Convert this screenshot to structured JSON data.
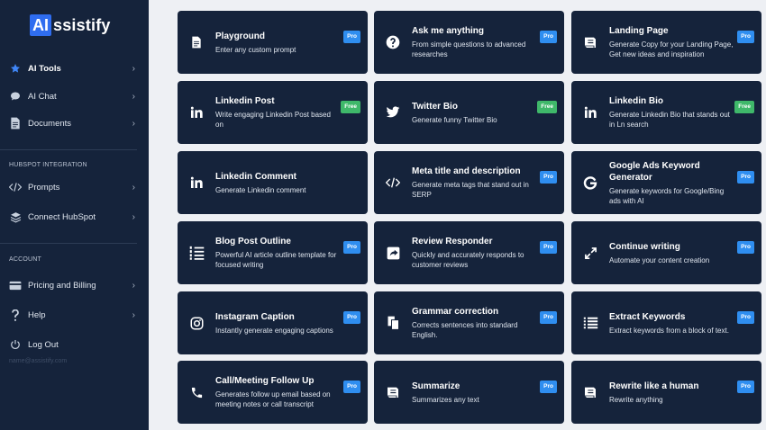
{
  "brand": {
    "box": "AI",
    "rest": "ssistify"
  },
  "sidebar": {
    "main": [
      {
        "label": "AI Tools",
        "icon": "star-icon",
        "active": true
      },
      {
        "label": "AI Chat",
        "icon": "chat-bubble-icon"
      },
      {
        "label": "Documents",
        "icon": "document-icon"
      }
    ],
    "hubspot_title": "HUBSPOT INTEGRATION",
    "hubspot": [
      {
        "label": "Prompts",
        "icon": "code-icon"
      },
      {
        "label": "Connect HubSpot",
        "icon": "layers-icon"
      }
    ],
    "account_title": "ACCOUNT",
    "account": [
      {
        "label": "Pricing and Billing",
        "icon": "credit-card-icon"
      },
      {
        "label": "Help",
        "icon": "question-icon"
      },
      {
        "label": "Log Out",
        "icon": "power-icon"
      }
    ],
    "email": "name@assistify.com"
  },
  "badges": {
    "pro": "Pro",
    "free": "Free"
  },
  "colors": {
    "sidebar_bg": "#15233b",
    "card_bg": "#15233b",
    "accent": "#2f6df0",
    "pro": "#2f8ef0",
    "free": "#3fb86a",
    "page_bg": "#eef0f4"
  },
  "tools": [
    {
      "title": "Playground",
      "desc": "Enter any custom prompt",
      "badge": "pro",
      "icon": "document-icon"
    },
    {
      "title": "Ask me anything",
      "desc": "From simple questions to advanced researches",
      "badge": "pro",
      "icon": "question-circle-icon"
    },
    {
      "title": "Landing Page",
      "desc": "Generate Copy for your Landing Page, Get new ideas and inspiration",
      "badge": "pro",
      "icon": "book-icon"
    },
    {
      "title": "Linkedin Post",
      "desc": "Write engaging Linkedin Post based on",
      "badge": "free",
      "icon": "linkedin-icon"
    },
    {
      "title": "Twitter Bio",
      "desc": "Generate funny Twitter Bio",
      "badge": "free",
      "icon": "twitter-icon"
    },
    {
      "title": "Linkedin Bio",
      "desc": "Generate Linkedin Bio that stands out in Ln search",
      "badge": "free",
      "icon": "linkedin-icon"
    },
    {
      "title": "Linkedin Comment",
      "desc": "Generate Linkedin comment",
      "badge": "",
      "icon": "linkedin-icon"
    },
    {
      "title": "Meta title and description",
      "desc": "Generate meta tags that stand out in SERP",
      "badge": "pro",
      "icon": "code-icon"
    },
    {
      "title": "Google Ads Keyword Generator",
      "desc": "Generate keywords for Google/Bing ads with AI",
      "badge": "pro",
      "icon": "google-icon"
    },
    {
      "title": "Blog Post Outline",
      "desc": "Powerful AI article outline template for focused writing",
      "badge": "pro",
      "icon": "list-numbered-icon"
    },
    {
      "title": "Review Responder",
      "desc": "Quickly and accurately responds to customer reviews",
      "badge": "pro",
      "icon": "share-icon"
    },
    {
      "title": "Continue writing",
      "desc": "Automate your content creation",
      "badge": "pro",
      "icon": "expand-icon"
    },
    {
      "title": "Instagram Caption",
      "desc": "Instantly generate engaging captions",
      "badge": "pro",
      "icon": "instagram-icon"
    },
    {
      "title": "Grammar correction",
      "desc": "Corrects sentences into standard English.",
      "badge": "pro",
      "icon": "copy-icon"
    },
    {
      "title": "Extract Keywords",
      "desc": "Extract keywords from a block of text.",
      "badge": "pro",
      "icon": "list-icon"
    },
    {
      "title": "Call/Meeting Follow Up",
      "desc": "Generates follow up email based on meeting notes or call transcript",
      "badge": "pro",
      "icon": "phone-icon"
    },
    {
      "title": "Summarize",
      "desc": "Summarizes any text",
      "badge": "pro",
      "icon": "book-icon"
    },
    {
      "title": "Rewrite like a human",
      "desc": "Rewrite anything",
      "badge": "pro",
      "icon": "book-icon"
    }
  ]
}
